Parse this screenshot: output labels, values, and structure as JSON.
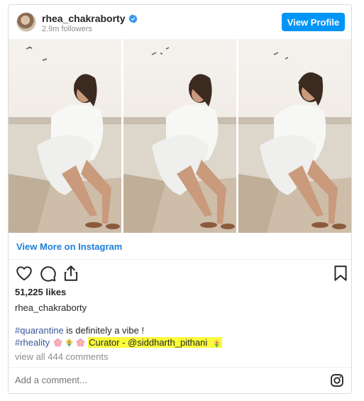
{
  "header": {
    "username": "rhea_chakraborty",
    "followers": "2.9m followers",
    "view_profile_label": "View Profile"
  },
  "post": {
    "photo_count": 3,
    "view_more_label": "View More on Instagram",
    "likes": "51,225 likes",
    "owner": "rhea_chakraborty",
    "caption_line1_tag": "#quarantine",
    "caption_line1_rest": " is definitely a vibe !",
    "caption_line2_tag": "#rheality",
    "caption_highlight": "Curator - @siddharth_pithani",
    "comments_label": "view all 444 comments"
  },
  "comment_box": {
    "placeholder": "Add a comment..."
  },
  "icons": {
    "verified": "verified-badge-icon",
    "like": "heart-icon",
    "comment": "comment-bubble-icon",
    "share": "share-icon",
    "save": "bookmark-icon",
    "instagram": "instagram-logo-icon"
  },
  "colors": {
    "primary_button": "#0095f6",
    "link": "#1d7fd6",
    "hashtag": "#385898",
    "highlight": "#fbfb3c",
    "muted_text": "#8e8e8e"
  }
}
